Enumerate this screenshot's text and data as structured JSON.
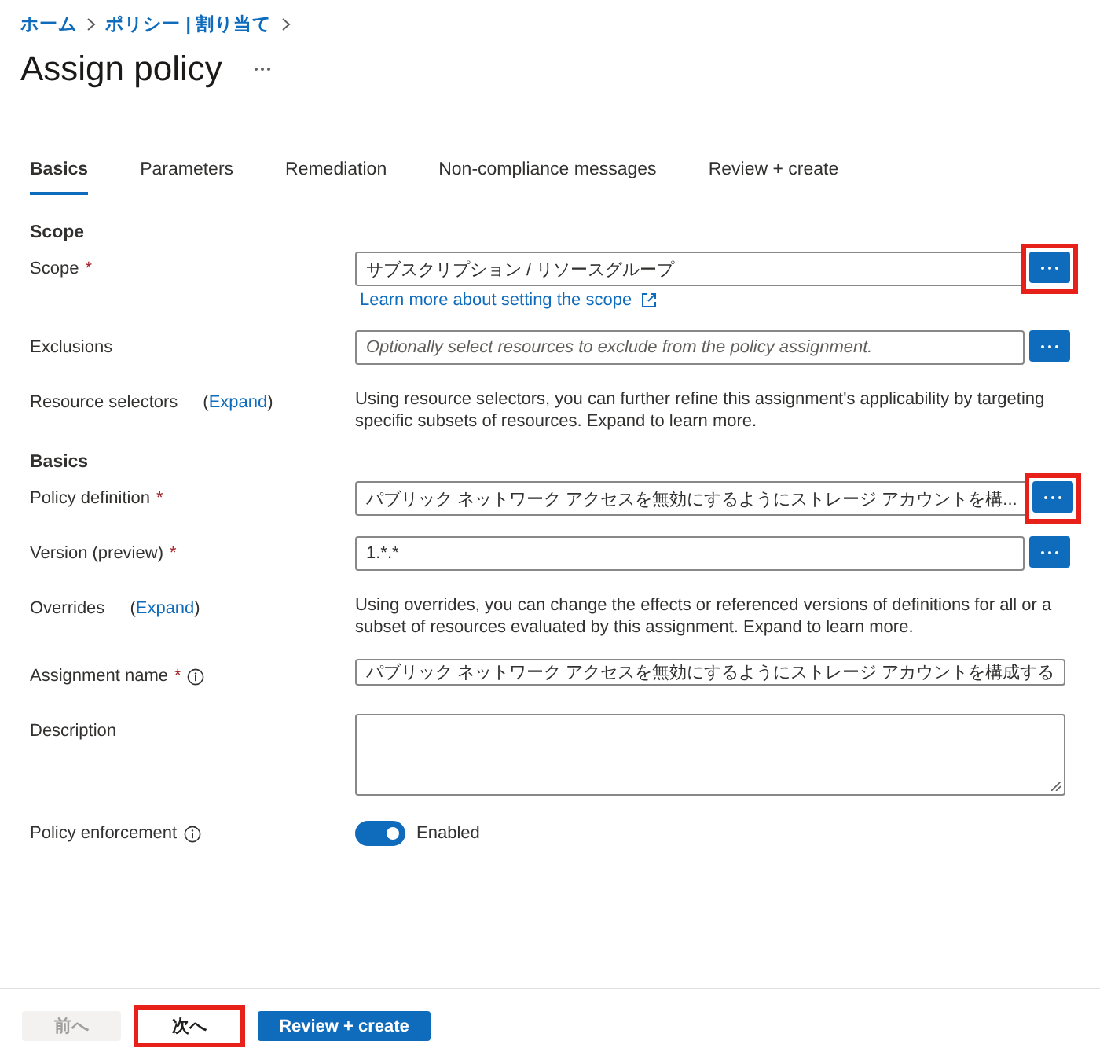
{
  "breadcrumb": [
    {
      "label": "ホーム"
    },
    {
      "label": "ポリシー | 割り当て"
    }
  ],
  "title": "Assign policy",
  "tabs": [
    {
      "label": "Basics",
      "selected": true
    },
    {
      "label": "Parameters",
      "selected": false
    },
    {
      "label": "Remediation",
      "selected": false
    },
    {
      "label": "Non-compliance messages",
      "selected": false
    },
    {
      "label": "Review + create",
      "selected": false
    }
  ],
  "sections": [
    {
      "heading": "Scope",
      "rows": [
        {
          "kind": "field",
          "label": "Scope",
          "required_mark": "*",
          "value": "サブスクリプション / リソースグループ",
          "highlighted": true,
          "link": "Learn more about setting the scope"
        },
        {
          "kind": "field",
          "label": "Exclusions",
          "placeholder": "Optionally select resources to exclude from the policy assignment.",
          "highlighted": false
        },
        {
          "kind": "info",
          "label": "Resource selectors",
          "expand": "(Expand)",
          "text": "Using resource selectors, you can further refine this assignment's applicability by targeting specific subsets of resources. Expand to learn more."
        }
      ]
    },
    {
      "heading": "Basics",
      "rows": [
        {
          "kind": "field",
          "label": "Policy definition",
          "required_mark": "*",
          "value": "パブリック ネットワーク アクセスを無効にするようにストレージ アカウントを構...",
          "highlighted": true
        },
        {
          "kind": "field",
          "label": "Version (preview)",
          "required_mark": "*",
          "value": "1.*.*",
          "highlighted": false
        },
        {
          "kind": "info",
          "label": "Overrides",
          "expand": "(Expand)",
          "text": "Using overrides, you can change the effects or referenced versions of definitions for all or a subset of resources evaluated by this assignment. Expand to learn more."
        },
        {
          "kind": "text",
          "label": "Assignment name",
          "required_mark": "*",
          "info_icon": true,
          "value": "パブリック ネットワーク アクセスを無効にするようにストレージ アカウントを構成する"
        },
        {
          "kind": "textarea",
          "label": "Description"
        },
        {
          "kind": "toggle",
          "label": "Policy enforcement",
          "info_icon": true,
          "on": true,
          "state_label": "Enabled"
        }
      ]
    }
  ],
  "footer": [
    {
      "label": "前へ",
      "kind": "secondary",
      "disabled": true,
      "highlighted": false
    },
    {
      "label": "次へ",
      "kind": "secondary",
      "disabled": false,
      "highlighted": true
    },
    {
      "label": "Review + create",
      "kind": "primary",
      "disabled": false,
      "highlighted": false
    }
  ]
}
